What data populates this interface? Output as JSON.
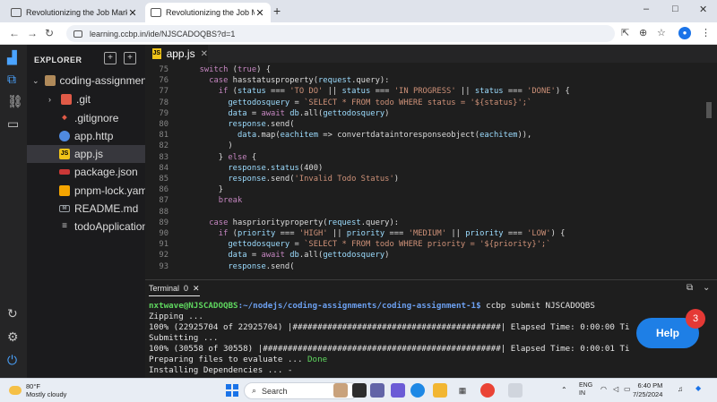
{
  "browser": {
    "tabs": [
      {
        "title": "Revolutionizing the Job Market"
      },
      {
        "title": "Revolutionizing the Job Market"
      }
    ],
    "url": "learning.ccbp.in/ide/NJSCADOQBS?d=1",
    "window_controls": [
      "–",
      "□",
      "✕"
    ]
  },
  "ide": {
    "explorer_title": "EXPLORER",
    "root_folder": "coding-assignment",
    "files": [
      {
        "name": ".git",
        "icon": "folder-git-icon",
        "color": "#e05a47"
      },
      {
        "name": ".gitignore",
        "icon": "git-icon",
        "color": "#e05a47"
      },
      {
        "name": "app.http",
        "icon": "globe-icon",
        "color": "#4f8ae0"
      },
      {
        "name": "app.js",
        "icon": "js-icon",
        "color": "#f0c419",
        "selected": true
      },
      {
        "name": "package.json",
        "icon": "npm-icon",
        "color": "#cb3837"
      },
      {
        "name": "pnpm-lock.yaml",
        "icon": "pnpm-icon",
        "color": "#f4a400"
      },
      {
        "name": "README.md",
        "icon": "markdown-icon",
        "color": "#9aa0a6"
      },
      {
        "name": "todoApplication.",
        "icon": "database-icon",
        "color": "#cccccc"
      }
    ],
    "editor_tab": "app.js",
    "code_lines": [
      {
        "n": "75",
        "text": "  switch (true) {"
      },
      {
        "n": "76",
        "text": "    case hasstatusproperty(request.query):"
      },
      {
        "n": "77",
        "text": "      if (status === 'TO DO' || status === 'IN PROGRESS' || status === 'DONE') {"
      },
      {
        "n": "78",
        "text": "        gettodosquery = `SELECT * FROM todo WHERE status = '${status}';`"
      },
      {
        "n": "79",
        "text": "        data = await db.all(gettodosquery)"
      },
      {
        "n": "80",
        "text": "        response.send("
      },
      {
        "n": "81",
        "text": "          data.map(eachitem => convertdataintoresponseobject(eachitem)),"
      },
      {
        "n": "82",
        "text": "        )"
      },
      {
        "n": "83",
        "text": "      } else {"
      },
      {
        "n": "84",
        "text": "        response.status(400)"
      },
      {
        "n": "85",
        "text": "        response.send('Invalid Todo Status')"
      },
      {
        "n": "86",
        "text": "      }"
      },
      {
        "n": "87",
        "text": "      break"
      },
      {
        "n": "88",
        "text": ""
      },
      {
        "n": "89",
        "text": "    case haspriorityproperty(request.query):"
      },
      {
        "n": "90",
        "text": "      if (priority === 'HIGH' || priority === 'MEDIUM' || priority === 'LOW') {"
      },
      {
        "n": "91",
        "text": "        gettodosquery = `SELECT * FROM todo WHERE priority = '${priority}';`"
      },
      {
        "n": "92",
        "text": "        data = await db.all(gettodosquery)"
      },
      {
        "n": "93",
        "text": "        response.send("
      }
    ],
    "terminal": {
      "tab_label": "Terminal",
      "tab_count": "0",
      "prompt_user": "nxtwave@NJSCADOQBS",
      "prompt_path": ":~/nodejs/coding-assignments/coding-assignment-1$",
      "command": " ccbp submit NJSCADOQBS",
      "lines": [
        "Zipping ...",
        "100% (22925704 of 22925704) |##########################################| Elapsed Time: 0:00:00 Ti",
        "Submitting ...",
        "100% (30558 of 30558) |################################################| Elapsed Time: 0:00:01 Ti"
      ],
      "evaluate_text": "Preparing files to evaluate ... ",
      "evaluate_status": "Done",
      "installing": "Installing Dependencies ... -"
    },
    "help_label": "Help",
    "help_badge": "3"
  },
  "taskbar": {
    "weather_temp": "80°F",
    "weather_desc": "Mostly cloudy",
    "search_label": "Search",
    "lang_top": "ENG",
    "lang_bottom": "IN",
    "time": "6:40 PM",
    "date": "7/25/2024"
  }
}
